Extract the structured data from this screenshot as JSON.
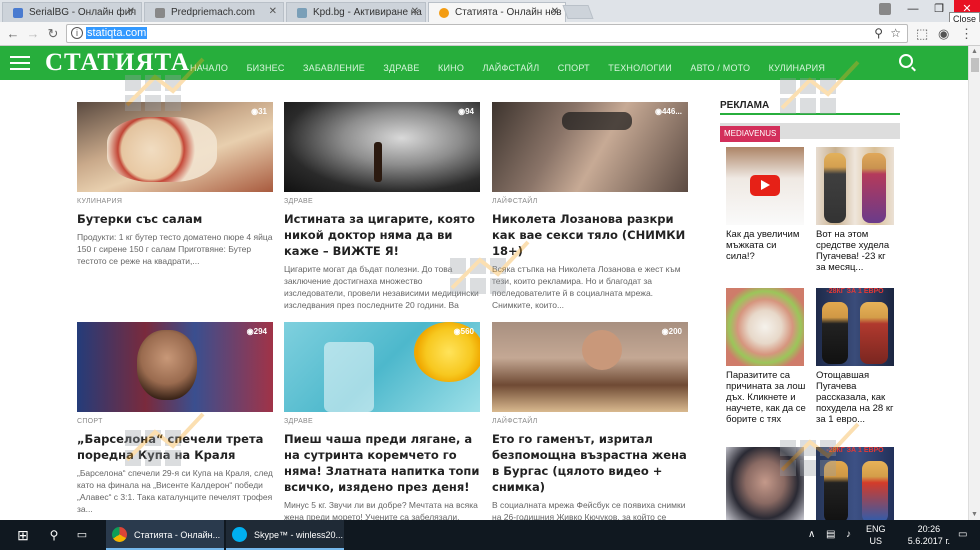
{
  "browser": {
    "tabs": [
      {
        "label": "SerialBG - Онлайн фил",
        "color": "#4a7bd0"
      },
      {
        "label": "Predpriemach.com",
        "color": "#888888"
      },
      {
        "label": "Kpd.bg - Активиране на",
        "color": "#7a9fb8"
      },
      {
        "label": "Статията - Онлайн нов",
        "color": "#f39c12"
      }
    ],
    "url": "statiqta.com",
    "close_tooltip": "Close"
  },
  "site": {
    "logo": "СТАТИЯТА",
    "nav": [
      "НАЧАЛО",
      "БИЗНЕС",
      "ЗАБАВЛЕНИЕ",
      "ЗДРАВЕ",
      "КИНО",
      "ЛАЙФСТАЙЛ",
      "СПОРТ",
      "ТЕХНОЛОГИИ",
      "АВТО / МОТО",
      "КУЛИНАРИЯ"
    ]
  },
  "articles": [
    {
      "views": "31",
      "category": "КУЛИНАРИЯ",
      "title": "Бутерки със салам",
      "excerpt": "Продукти: 1 кг бутер тесто доматено пюре 4 яйца 150 г сирене 150 г салам Приготвяне: Бутер тестото се реже на квадрати,..."
    },
    {
      "views": "94",
      "category": "ЗДРАВЕ",
      "title": "Истината за цигарите, която никой доктор няма да ви каже – ВИЖТЕ Я!",
      "excerpt": "Цигарите могат да бъдат полезни. До това заключение достигнаха множество изследователи, провели независими медицински изследвания през последните 20 години. Ва препоръчителните медицински..."
    },
    {
      "views": "446...",
      "category": "ЛАЙФСТАЙЛ",
      "title": "Николета Лозанова разкри как вае секси тяло (СНИМКИ 18+)",
      "excerpt": "Всяка стъпка на Николета Лозанова е жест към тези, които рекламира. Но и благодат за последователите й в социалната мрежа. Снимките, които..."
    },
    {
      "views": "294",
      "category": "СПОРТ",
      "title": "„Барселона“ спечели трета поредна Купа на Краля",
      "excerpt": "„Барселона“ спечели 29-я си Купа на Краля, след като на финала на „Висенте Калдерон“ победи „Алавес“ с 3:1. Така каталунците печелят трофея за..."
    },
    {
      "views": "560",
      "category": "ЗДРАВЕ",
      "title": "Пиеш чаша преди лягане, а на сутринта коремчето го няма! Златната напитка топи всичко, изядено през деня!",
      "excerpt": "Минус 5 кг. Звучи ли ви добре? Мечтата на всяка жена преди морето! Учените са забелязали, обаче, че повечето от жените си..."
    },
    {
      "views": "200",
      "category": "ЛАЙФСТАЙЛ",
      "title": "Ето го гаменът, изритал безпомощна възрастна жена в Бургас (цялото видео + снимка)",
      "excerpt": "В социалната мрежа Фейсбук се появиха снимки на 26-годишния Живко Кючуков, за който се твърди, че е задържан за бруталното нападение на..."
    }
  ],
  "sidebar": {
    "heading": "РЕКЛАМА",
    "sponsor": "MEDIAVENUS",
    "ads": [
      {
        "caption": "Как да увеличим мъжката си сила!?",
        "badge": ""
      },
      {
        "caption": "Вот на этом средстве худела Пугачева! -23 кг за месяц...",
        "badge": ""
      },
      {
        "caption": "Паразитите са причината за лош дъх. Кликнете и научете, как да се борите с тях",
        "badge": ""
      },
      {
        "caption": "Отощавшая Пугачева рассказала, как похудела на 28 кг за 1 евро...",
        "badge": "-28КГ ЗА 1 ЕВРО"
      },
      {
        "caption": "",
        "badge": ""
      },
      {
        "caption": "",
        "badge": "-28КГ ЗА 1 ЕВРО"
      }
    ]
  },
  "taskbar": {
    "apps": [
      "Статията - Онлайн...",
      "Skype™ - winless20..."
    ],
    "lang": "ENG",
    "region": "US",
    "time": "20:26",
    "date": "5.6.2017 г."
  }
}
